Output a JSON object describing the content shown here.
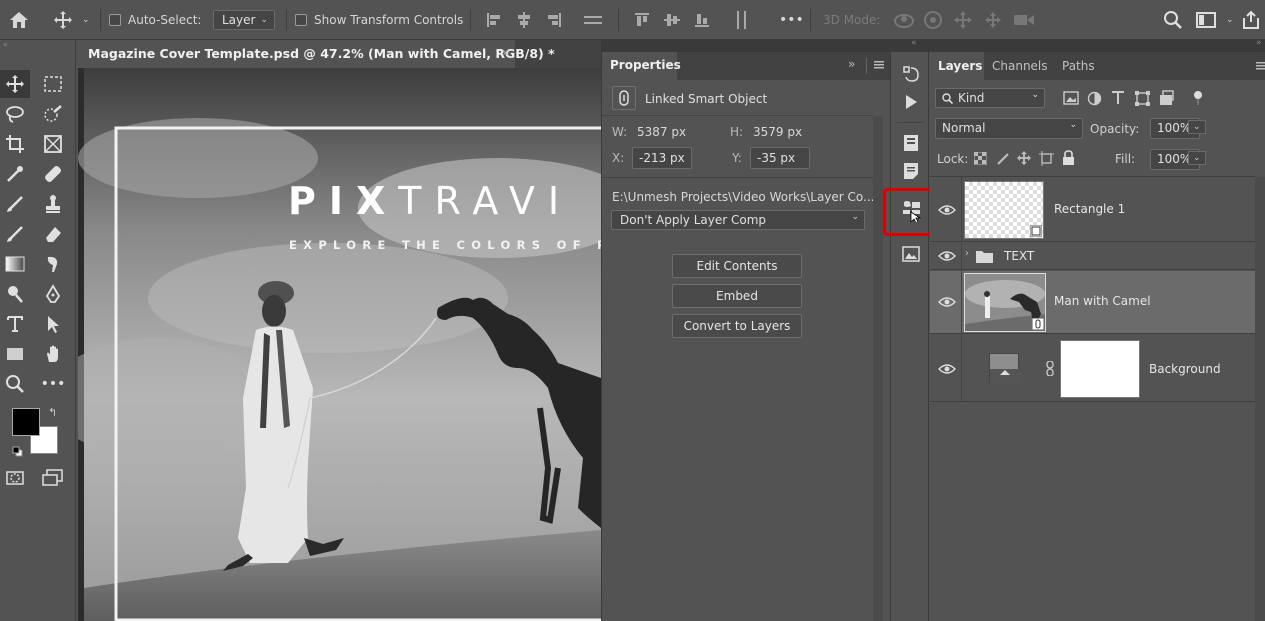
{
  "colors": {
    "accent_highlight": "#e00000",
    "panel_bg": "#535353",
    "tab_bg": "#424242"
  },
  "optionsbar": {
    "auto_select_label": "Auto-Select:",
    "layer_select_value": "Layer",
    "show_transform_label": "Show Transform Controls",
    "more_label": "•••",
    "mode_3d_label": "3D Mode:"
  },
  "document": {
    "tab_title": "Magazine Cover Template.psd @ 47.2% (Man with Camel, RGB/8) *",
    "close_label": "×",
    "canvas_title_bold": "PIX",
    "canvas_title_light": "TRAVI",
    "canvas_subtitle": "EXPLORE THE COLORS OF RAJA"
  },
  "properties": {
    "tab_label": "Properties",
    "type_label": "Linked Smart Object",
    "w_label": "W:",
    "w_value": "5387 px",
    "h_label": "H:",
    "h_value": "3579 px",
    "x_label": "X:",
    "x_value": "-213 px",
    "y_label": "Y:",
    "y_value": "-35 px",
    "path": "E:\\Unmesh Projects\\Video Works\\Layer Co...",
    "layer_comp_value": "Don't Apply Layer Comp",
    "btn_edit": "Edit Contents",
    "btn_embed": "Embed",
    "btn_convert": "Convert to Layers"
  },
  "layers_panel": {
    "tabs": [
      "Layers",
      "Channels",
      "Paths"
    ],
    "kind_value": "Kind",
    "blend_value": "Normal",
    "opacity_label": "Opacity:",
    "opacity_value": "100%",
    "lock_label": "Lock:",
    "fill_label": "Fill:",
    "fill_value": "100%",
    "layers": [
      {
        "name": "Rectangle 1"
      },
      {
        "name": "TEXT"
      },
      {
        "name": "Man with Camel"
      },
      {
        "name": "Background"
      }
    ]
  }
}
